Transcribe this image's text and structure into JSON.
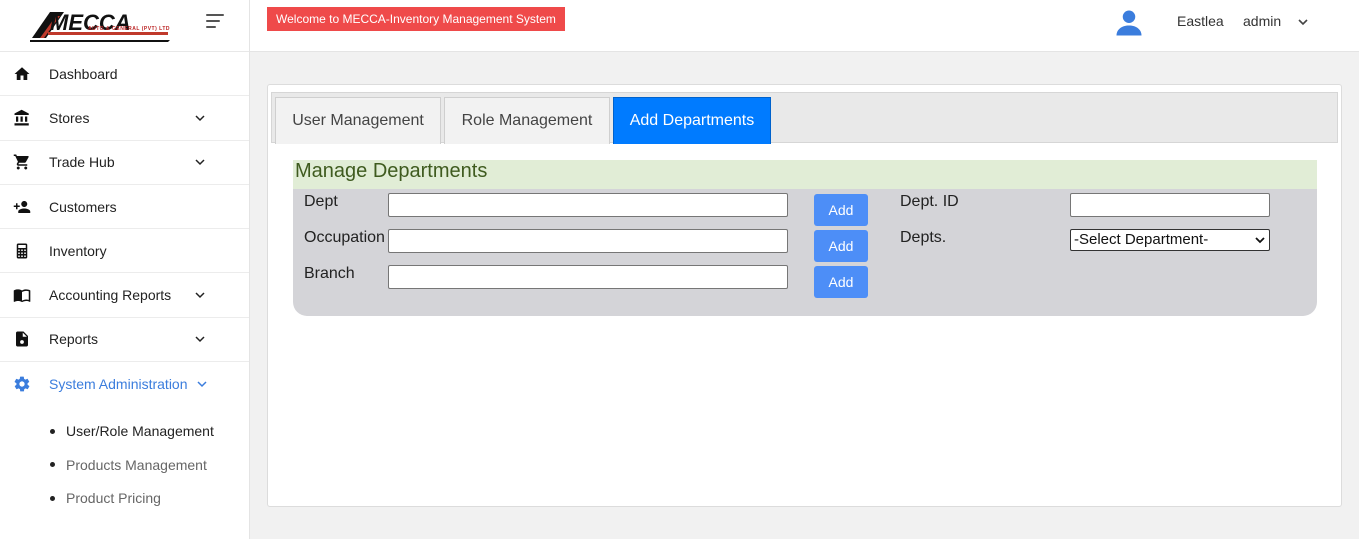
{
  "brand": {
    "logo_text": "MECCA",
    "logo_subtitle": "AUTO & GENERAL (PVT) LTD",
    "accent_color": "#ef4a4a"
  },
  "header": {
    "welcome": "Welcome to MECCA-Inventory Management System",
    "branch": "Eastlea",
    "username": "admin"
  },
  "sidebar": {
    "items": [
      {
        "label": "Dashboard",
        "icon": "home-icon"
      },
      {
        "label": "Stores",
        "icon": "bank-icon"
      },
      {
        "label": "Trade Hub",
        "icon": "cart-icon"
      },
      {
        "label": "Customers",
        "icon": "person-add-icon"
      },
      {
        "label": "Inventory",
        "icon": "calculator-icon"
      },
      {
        "label": "Accounting Reports",
        "icon": "book-icon"
      },
      {
        "label": "Reports",
        "icon": "file-icon"
      },
      {
        "label": "System Administration",
        "icon": "gear-icon"
      }
    ],
    "subitems": [
      {
        "label": "User/Role Management"
      },
      {
        "label": "Products Management"
      },
      {
        "label": "Product Pricing"
      }
    ]
  },
  "tabs": [
    {
      "label": "User Management"
    },
    {
      "label": "Role Management"
    },
    {
      "label": "Add Departments"
    }
  ],
  "form": {
    "title": "Manage Departments",
    "dept_label": "Dept",
    "dept_value": "",
    "occupation_label": "Occupation",
    "occupation_value": "",
    "branch_label": "Branch",
    "branch_value": "",
    "add_label": "Add",
    "dept_id_label": "Dept. ID",
    "dept_id_value": "",
    "depts_label": "Depts.",
    "depts_selected": "-Select Department-"
  }
}
